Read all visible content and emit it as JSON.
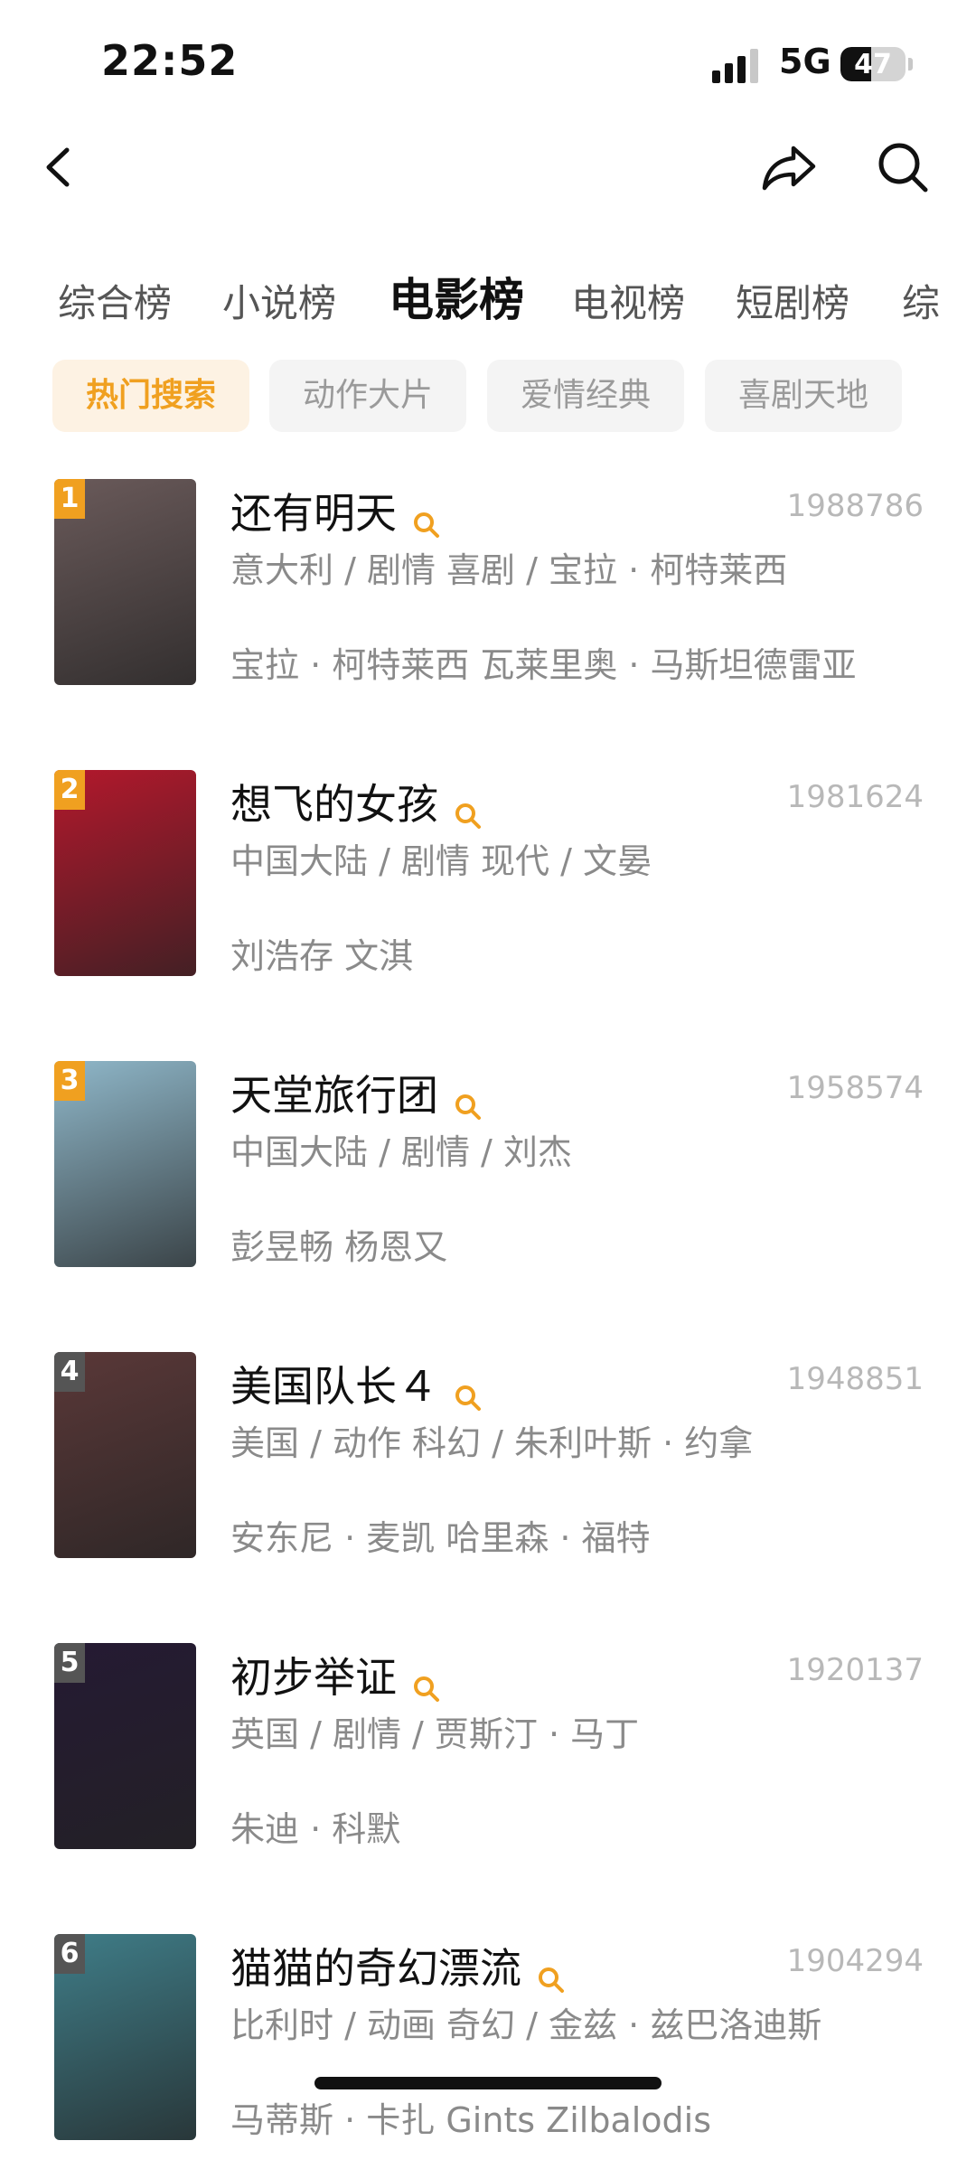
{
  "status": {
    "time": "22:52",
    "network": "5G",
    "battery": "47",
    "battery_level": 0.47
  },
  "tabs": [
    {
      "label": "综合榜",
      "active": false
    },
    {
      "label": "小说榜",
      "active": false
    },
    {
      "label": "电影榜",
      "active": true
    },
    {
      "label": "电视榜",
      "active": false
    },
    {
      "label": "短剧榜",
      "active": false
    },
    {
      "label": "综",
      "active": false
    }
  ],
  "chips": [
    {
      "label": "热门搜索",
      "active": true
    },
    {
      "label": "动作大片",
      "active": false
    },
    {
      "label": "爱情经典",
      "active": false
    },
    {
      "label": "喜剧天地",
      "active": false
    }
  ],
  "colors": {
    "accent": "#f0a020",
    "rank_orange": "#f0a020",
    "rank_gray": "#555555"
  },
  "movies": [
    {
      "rank": "1",
      "title": "还有明天",
      "score": "1988786",
      "meta": "意大利 / 剧情 喜剧 / 宝拉 · 柯特莱西",
      "cast": "宝拉 · 柯特莱西 瓦莱里奥 · 马斯坦德雷亚",
      "poster_color": "#6a5a5a"
    },
    {
      "rank": "2",
      "title": "想飞的女孩",
      "score": "1981624",
      "meta": "中国大陆 / 剧情 现代 / 文晏",
      "cast": "刘浩存 文淇",
      "poster_color": "#b3182c"
    },
    {
      "rank": "3",
      "title": "天堂旅行团",
      "score": "1958574",
      "meta": "中国大陆 / 剧情 / 刘杰",
      "cast": "彭昱畅 杨恩又",
      "poster_color": "#8fb7c9"
    },
    {
      "rank": "4",
      "title": "美国队长４",
      "score": "1948851",
      "meta": "美国 / 动作 科幻 / 朱利叶斯 · 约拿",
      "cast": "安东尼 · 麦凯 哈里森 · 福特",
      "poster_color": "#5a3838"
    },
    {
      "rank": "5",
      "title": "初步举证",
      "score": "1920137",
      "meta": "英国 / 剧情 / 贾斯汀 · 马丁",
      "cast": "朱迪 · 科默",
      "poster_color": "#251a33"
    },
    {
      "rank": "6",
      "title": "猫猫的奇幻漂流",
      "score": "1904294",
      "meta": "比利时 / 动画 奇幻 / 金兹 · 兹巴洛迪斯",
      "cast": "马蒂斯 · 卡扎 Gints Zilbalodis",
      "poster_color": "#3f7d88"
    }
  ]
}
